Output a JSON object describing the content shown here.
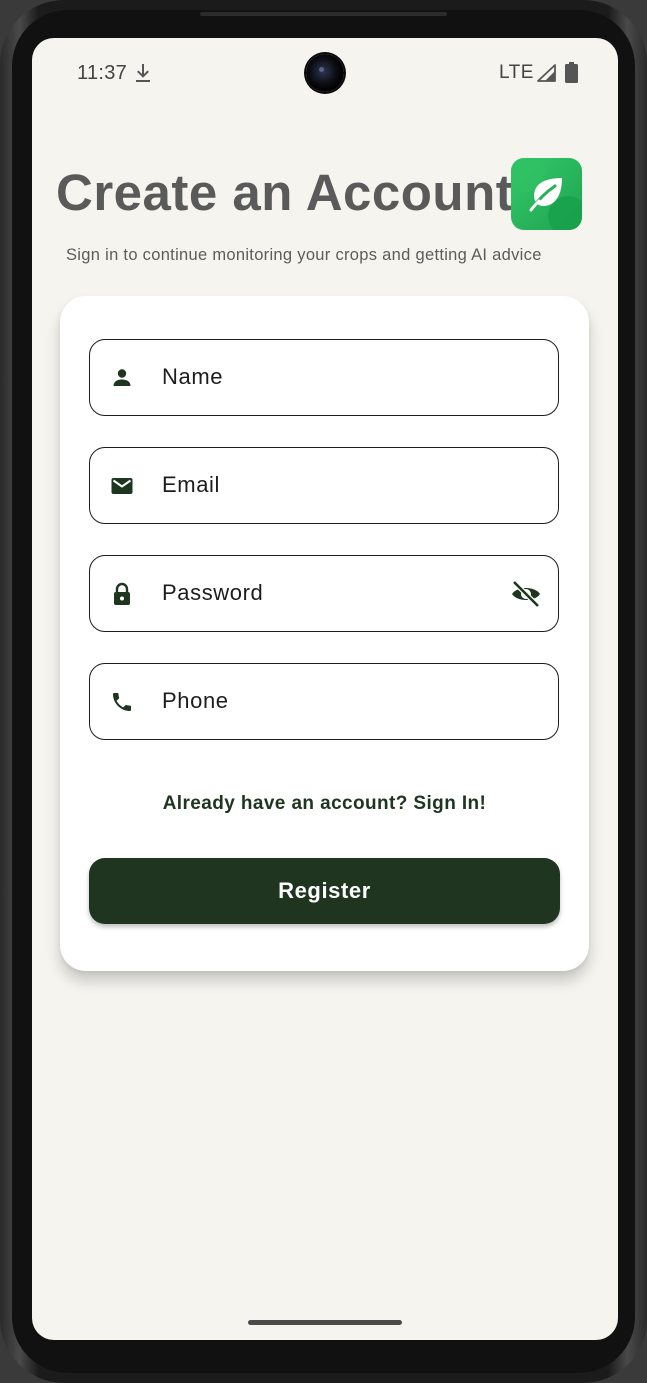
{
  "status_bar": {
    "time": "11:37",
    "network": "LTE"
  },
  "header": {
    "title": "Create an Account",
    "subtitle": "Sign in to continue monitoring your crops and getting AI advice"
  },
  "form": {
    "name_placeholder": "Name",
    "email_placeholder": "Email",
    "password_placeholder": "Password",
    "phone_placeholder": "Phone",
    "signin_link": "Already have an account? Sign In!",
    "register_label": "Register"
  },
  "colors": {
    "background": "#f5f4ef",
    "primary_dark_green": "#1f3520",
    "logo_green": "#2bb95c",
    "title_gray": "#5a5a5a"
  },
  "icons": {
    "name_field": "person-icon",
    "email_field": "mail-icon",
    "password_field": "lock-icon",
    "password_toggle": "eye-off-icon",
    "phone_field": "phone-icon",
    "logo": "leaf-icon"
  }
}
